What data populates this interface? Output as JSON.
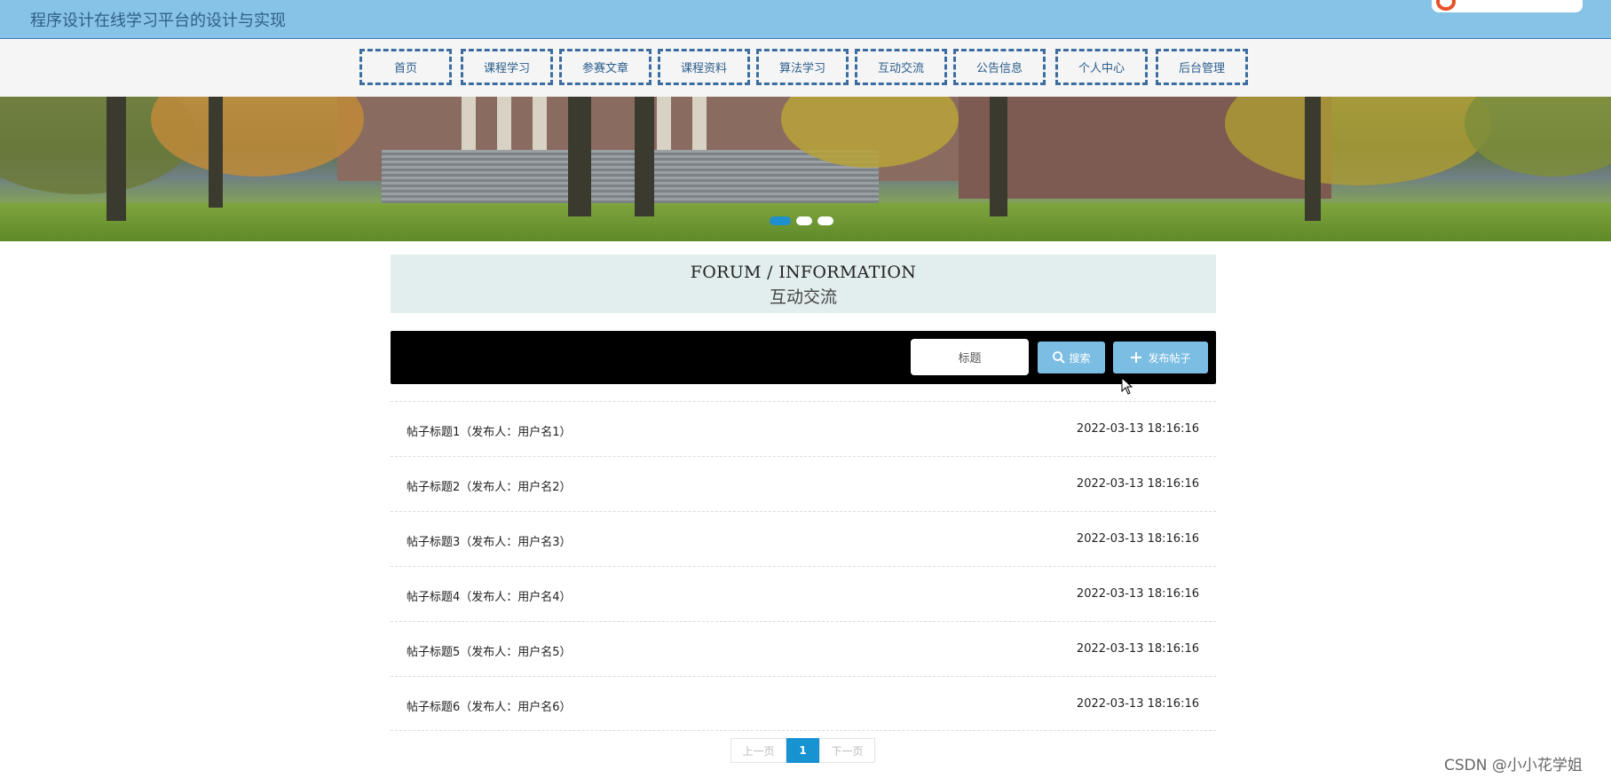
{
  "header": {
    "site_title": "程序设计在线学习平台的设计与实现"
  },
  "nav": {
    "items": [
      {
        "label": "首页"
      },
      {
        "label": "课程学习"
      },
      {
        "label": "参赛文章"
      },
      {
        "label": "课程资料"
      },
      {
        "label": "算法学习"
      },
      {
        "label": "互动交流"
      },
      {
        "label": "公告信息"
      },
      {
        "label": "个人中心"
      },
      {
        "label": "后台管理"
      }
    ]
  },
  "banner": {
    "slide_count": 3,
    "active_slide": 1
  },
  "section": {
    "title_en": "FORUM / INFORMATION",
    "title_cn": "互动交流"
  },
  "toolbar": {
    "search_value": "标题",
    "search_label": "搜索",
    "post_label": "发布帖子"
  },
  "posts": [
    {
      "title": "帖子标题1（发布人：用户名1）",
      "time": "2022-03-13 18:16:16"
    },
    {
      "title": "帖子标题2（发布人：用户名2）",
      "time": "2022-03-13 18:16:16"
    },
    {
      "title": "帖子标题3（发布人：用户名3）",
      "time": "2022-03-13 18:16:16"
    },
    {
      "title": "帖子标题4（发布人：用户名4）",
      "time": "2022-03-13 18:16:16"
    },
    {
      "title": "帖子标题5（发布人：用户名5）",
      "time": "2022-03-13 18:16:16"
    },
    {
      "title": "帖子标题6（发布人：用户名6）",
      "time": "2022-03-13 18:16:16"
    }
  ],
  "pager": {
    "prev_label": "上一页",
    "current_page": "1",
    "next_label": "下一页"
  },
  "watermark": "CSDN @小小花学姐",
  "colors": {
    "header_bg": "#87c3e6",
    "nav_border": "#3c6d9e",
    "button_bg": "#7bbde3",
    "pager_active": "#1793d1"
  }
}
